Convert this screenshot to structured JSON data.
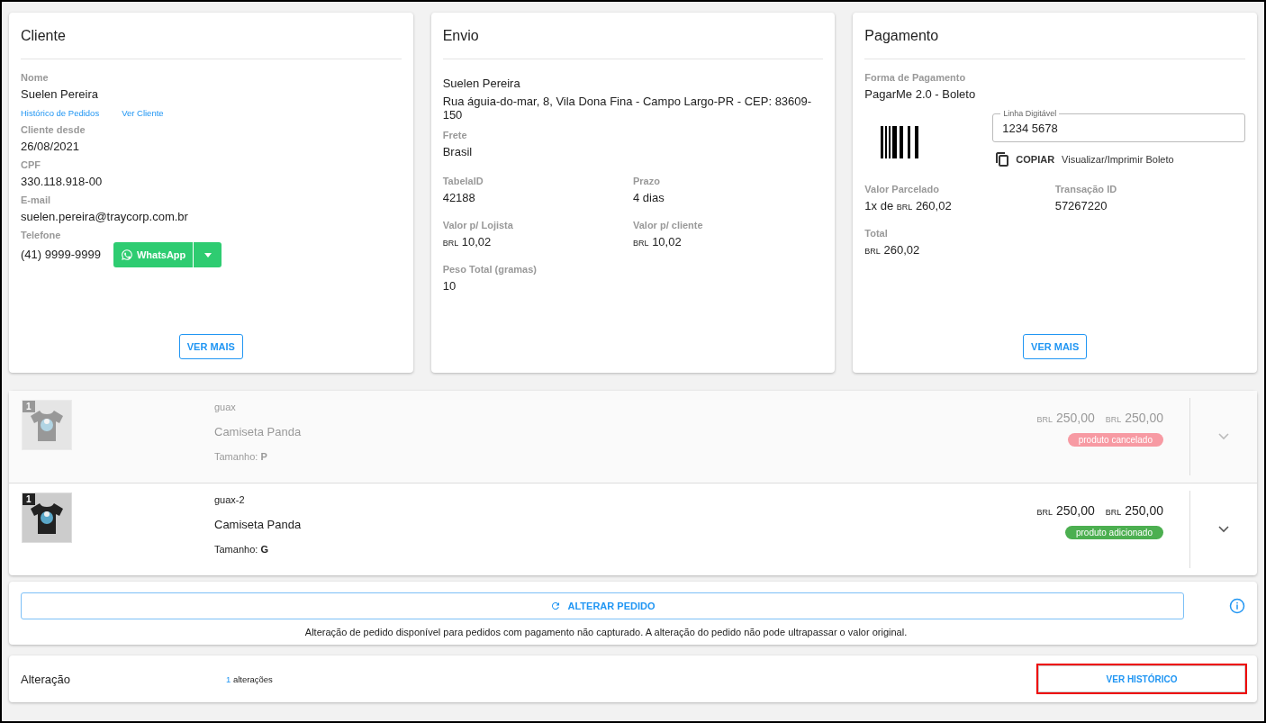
{
  "cliente": {
    "title": "Cliente",
    "nome_label": "Nome",
    "nome": "Suelen Pereira",
    "links": [
      "Histórico de Pedidos",
      "Ver Cliente"
    ],
    "fields": [
      {
        "label": "Cliente desde",
        "value": "26/08/2021"
      },
      {
        "label": "CPF",
        "value": "330.118.918-00"
      },
      {
        "label": "E-mail",
        "value": "suelen.pereira@traycorp.com.br"
      }
    ],
    "telefone_label": "Telefone",
    "telefone": "(41) 9999-9999",
    "whatsapp": "WhatsApp",
    "more": "VER MAIS"
  },
  "envio": {
    "title": "Envio",
    "nome": "Suelen Pereira",
    "endereco": "Rua águia-do-mar, 8, Vila Dona Fina - Campo Largo-PR - CEP: 83609-150",
    "frete_label": "Frete",
    "frete": "Brasil",
    "grid": [
      {
        "label": "TabelaID",
        "value": "42188"
      },
      {
        "label": "Prazo",
        "value": "4 dias"
      },
      {
        "label": "Valor p/ Lojista",
        "currency": "BRL",
        "value": "10,02"
      },
      {
        "label": "Valor p/ cliente",
        "currency": "BRL",
        "value": "10,02"
      },
      {
        "label": "Peso Total (gramas)",
        "value": "10"
      }
    ]
  },
  "pagamento": {
    "title": "Pagamento",
    "forma_label": "Forma de Pagamento",
    "forma": "PagarMe 2.0 - Boleto",
    "linha_label": "Linha Digitável",
    "linha": "1234 5678",
    "copiar": "COPIAR",
    "visualizar": "Visualizar/Imprimir Boleto",
    "grid": [
      {
        "label": "Valor Parcelado",
        "prefix": "1x de",
        "currency": "BRL",
        "value": "260,02"
      },
      {
        "label": "Transação ID",
        "value": "57267220"
      },
      {
        "label": "Total",
        "currency": "BRL",
        "value": "260,02"
      }
    ],
    "more": "VER MAIS"
  },
  "items": [
    {
      "kind": "cancelled",
      "qty": "1",
      "sku": "guax",
      "name": "Camiseta Panda",
      "size_label": "Tamanho:",
      "size": "P",
      "prices": [
        {
          "currency": "BRL",
          "value": "250,00"
        },
        {
          "currency": "BRL",
          "value": "250,00"
        }
      ],
      "status": "produto cancelado",
      "color": "#f79aa3"
    },
    {
      "kind": "added",
      "qty": "1",
      "sku": "guax-2",
      "name": "Camiseta Panda",
      "size_label": "Tamanho:",
      "size": "G",
      "prices": [
        {
          "currency": "BRL",
          "value": "250,00"
        },
        {
          "currency": "BRL",
          "value": "250,00"
        }
      ],
      "status": "produto adicionado",
      "color": "#4caf50"
    }
  ],
  "alterar": {
    "button": "ALTERAR PEDIDO",
    "note": "Alteração de pedido disponível para pedidos com pagamento não capturado. A alteração do pedido não pode ultrapassar o valor original."
  },
  "alteracao": {
    "label": "Alteração",
    "count": "1",
    "count_text": "alterações",
    "button": "VER HISTÓRICO",
    "highlighted": true
  }
}
